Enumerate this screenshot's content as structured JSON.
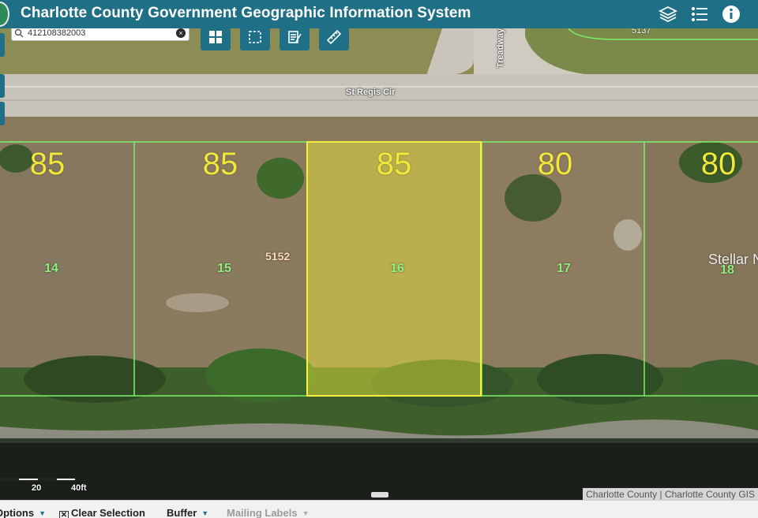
{
  "header": {
    "title": "Charlotte County Government Geographic Information System",
    "background": "#1f6f86"
  },
  "header_buttons": {
    "layers_icon": "layers-icon",
    "legend_icon": "legend-list-icon",
    "info_icon": "info-icon"
  },
  "search": {
    "value": "412108382003",
    "clear_icon": "close-icon"
  },
  "tools": [
    "grid-icon",
    "select-box-icon",
    "edit-notes-icon",
    "measure-ruler-icon"
  ],
  "map": {
    "streets": [
      {
        "name": "St Regis Cir"
      },
      {
        "name": "Treadway B"
      }
    ],
    "top_number": "5137",
    "parcels": [
      {
        "frontage": "85",
        "lot": "14"
      },
      {
        "frontage": "85",
        "lot": "15",
        "address": "5152"
      },
      {
        "frontage": "85",
        "lot": "16",
        "selected": true
      },
      {
        "frontage": "80",
        "lot": "17"
      },
      {
        "frontage": "80",
        "lot": "18"
      }
    ],
    "subdivision_label": "Stellar N",
    "selection_color": "#f5f03a",
    "parcel_line_color": "#7cf26a"
  },
  "scale": {
    "label_mid": "20",
    "label_end": "40ft"
  },
  "attribution": "Charlotte County | Charlotte County GIS",
  "bottom_bar": {
    "options_label": "Options",
    "clear_selection_label": "Clear Selection",
    "buffer_label": "Buffer",
    "mailing_labels_label": "Mailing Labels"
  }
}
